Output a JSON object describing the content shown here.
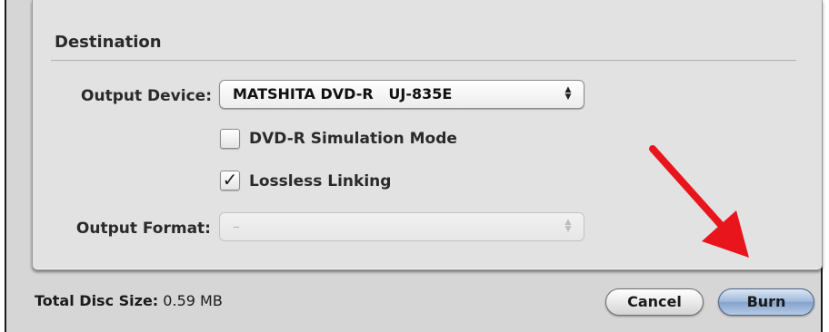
{
  "destination": {
    "title": "Destination",
    "output_device_label": "Output Device:",
    "output_device_value": "MATSHITA DVD-R   UJ-835E",
    "simulation_label": "DVD-R Simulation Mode",
    "simulation_checked": false,
    "lossless_label": "Lossless Linking",
    "lossless_checked": true,
    "output_format_label": "Output Format:",
    "output_format_value": "–"
  },
  "footer": {
    "size_label": "Total Disc Size:",
    "size_value": "0.59 MB",
    "cancel_label": "Cancel",
    "burn_label": "Burn"
  },
  "icons": {
    "popup_arrows": "up-down-chevrons",
    "check": "checkmark",
    "annotation": "red-arrow"
  },
  "colors": {
    "annotation_arrow": "#e8161c",
    "default_button": "#9fb8d9"
  }
}
